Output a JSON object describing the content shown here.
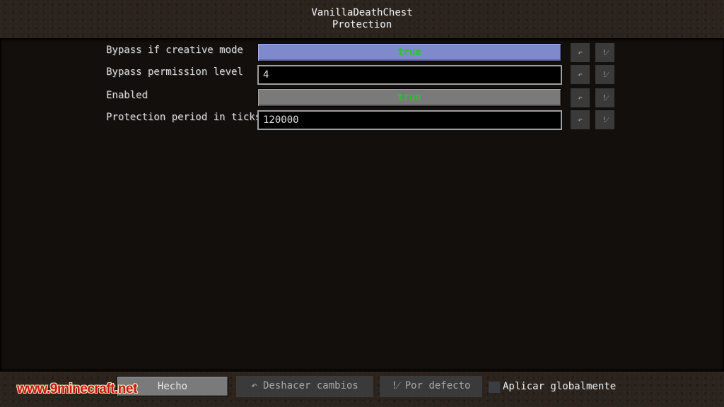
{
  "header": {
    "title": "VanillaDeathChest",
    "subtitle": "Protection"
  },
  "config": {
    "rows": [
      {
        "label": "Bypass if creative mode",
        "type": "toggle",
        "value": "true",
        "state": "hover"
      },
      {
        "label": "Bypass permission level",
        "type": "text",
        "value": "4"
      },
      {
        "label": "Enabled",
        "type": "toggle",
        "value": "true",
        "state": "normal"
      },
      {
        "label": "Protection period in ticks",
        "type": "text",
        "value": "120000"
      }
    ],
    "undo_icon": "↶",
    "default_icon": "!⁄"
  },
  "footer": {
    "done_label": "Hecho",
    "undo_label": "↶ Deshacer cambios",
    "default_label": "!⁄ Por defecto",
    "apply_globally_label": "Aplicar globalmente",
    "apply_globally_checked": false
  },
  "watermark": "www.9minecraft.net",
  "colors": {
    "toggle_true_text": "#2fbf2f",
    "toggle_hover_bg": "#7f8acc",
    "toggle_normal_bg": "#7a7a7a",
    "watermark_red": "#c8161c"
  }
}
